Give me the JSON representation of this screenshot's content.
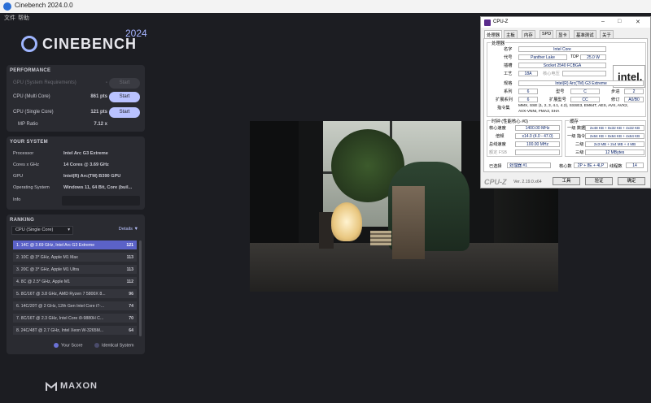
{
  "cinebench": {
    "window_title": "Cinebench 2024.0.0",
    "menu": [
      "文件",
      "帮助"
    ],
    "logo_text": "CINEBENCH",
    "logo_year": "2024",
    "performance": {
      "heading": "PERFORMANCE",
      "gpu_label": "GPU (System Requirements)",
      "gpu_value": "-",
      "multi_label": "CPU (Multi Core)",
      "multi_value": "861 pts",
      "single_label": "CPU (Single Core)",
      "single_value": "121 pts",
      "ratio_label": "MP Ratio",
      "ratio_value": "7.12 x",
      "start_label": "Start"
    },
    "system": {
      "heading": "YOUR SYSTEM",
      "rows": [
        {
          "label": "Processor",
          "value": "Intel Arc G3 Extreme"
        },
        {
          "label": "Cores x GHz",
          "value": "14 Cores @ 3.69 GHz"
        },
        {
          "label": "GPU",
          "value": "Intel(R) Arc(TM) B390 GPU"
        },
        {
          "label": "Operating System",
          "value": "Windows 11, 64 Bit, Core (buil..."
        },
        {
          "label": "Info",
          "value": ""
        }
      ]
    },
    "ranking": {
      "heading": "RANKING",
      "select_value": "CPU (Single Core)",
      "details_label": "Details",
      "rows": [
        {
          "name": "1. 14C @ 3.69 GHz, Intel Arc G3 Extreme",
          "score": "121"
        },
        {
          "name": "2. 10C @ 3* GHz, Apple M1 Max",
          "score": "113"
        },
        {
          "name": "3. 20C @ 3* GHz, Apple M1 Ultra",
          "score": "113"
        },
        {
          "name": "4. 8C @ 2.5* GHz, Apple M1",
          "score": "112"
        },
        {
          "name": "5. 8C/16T @ 3.8 GHz, AMD Ryzen 7 5800X 8...",
          "score": "96"
        },
        {
          "name": "6. 14C/20T @ 2 GHz, 12th Gen Intel Core i7-...",
          "score": "74"
        },
        {
          "name": "7. 8C/16T @ 2.3 GHz, Intel Core i9-9880H C...",
          "score": "70"
        },
        {
          "name": "8. 24C/48T @ 2.7 GHz, Intel Xeon W-3265M...",
          "score": "64"
        }
      ],
      "legend_your": "Your Score",
      "legend_identical": "Identical System"
    },
    "footer_brand": "MAXON"
  },
  "cpuz": {
    "title": "CPU-Z",
    "tabs": [
      "处理器",
      "主板",
      "内存",
      "SPD",
      "显卡",
      "基准测试",
      "关于"
    ],
    "processor_group": "处理器",
    "name_label": "名字",
    "name_value": "Intel Core",
    "codename_label": "代号",
    "codename_value": "Panther Lake",
    "tdp_label": "TDP",
    "tdp_value": "25.0 W",
    "package_label": "插槽",
    "package_value": "Socket 2540 FCBGA",
    "tech_label": "工艺",
    "tech_value": "18A",
    "voltage_label": "核心电压",
    "voltage_value": "",
    "spec_label": "规格",
    "spec_value": "Intel(R) Arc(TM) G3 Extreme",
    "family_label": "系列",
    "family_value": "6",
    "model_label": "型号",
    "model_value": "C",
    "stepping_label": "步进",
    "stepping_value": "2",
    "extfamily_label": "扩展系列",
    "extfamily_value": "6",
    "extmodel_label": "扩展型号",
    "extmodel_value": "CC",
    "revision_label": "修订",
    "revision_value": "A0/B0",
    "instr_label": "指令集",
    "instr_value_1": "MMX, SSE (1, 2, 3, 4.1, 4.2), SSSE3, EM64T, AES, AVX, AVX2,",
    "instr_value_2": "AVX-VNNI, FMA3, SHA",
    "clocks_group": "时钟 (性能核心 #0)",
    "core_speed_label": "核心速度",
    "core_speed_value": "1400.00 MHz",
    "multiplier_label": "倍频",
    "multiplier_value": "x14.0 (4.0 - 47.0)",
    "bus_label": "总线速度",
    "bus_value": "100.00 MHz",
    "fsb_label": "额定 FSB",
    "fsb_value": "",
    "cache_group": "缓存",
    "l1d_label": "一级 数据",
    "l1d_value": "2x48 KB + 8x32 KB + 4x32 KB",
    "l1i_label": "一级 指令",
    "l1i_value": "2x64 KB + 8x64 KB + 4x64 KB",
    "l2_label": "二级",
    "l2_value": "2x3 MB + 2x4 MB + 4 MB",
    "l3_label": "三级",
    "l3_value": "12 MBytes",
    "selected_label": "已选择",
    "selected_value": "处理器 #1",
    "cores_label": "核心数",
    "cores_value": "2P + 8E + 4LP",
    "threads_label": "线程数",
    "threads_value": "14",
    "brand": "CPU-Z",
    "version": "Ver. 2.19.0.x64",
    "tools_label": "工具",
    "validate_label": "验证",
    "ok_label": "确定",
    "logo": "intel."
  }
}
